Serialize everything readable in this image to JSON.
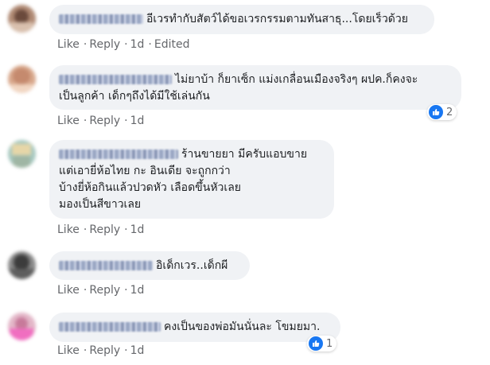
{
  "actions": {
    "like": "Like",
    "reply": "Reply",
    "dot": "·"
  },
  "comments": [
    {
      "text": "อีเวรทำกับสัตว์ได้ขอเวรกรรมตามทันสาธุ...โดยเร็วด้วย",
      "time": "1d",
      "edited": "Edited"
    },
    {
      "text": "ไม่ยาบ้า ก็ยาเซ็ก แม่งเกลื่อนเมืองจริงๆ ผปค.ก็คงจะ\nเป็นลูกค้า เด็กๆถึงได้มีใช้เล่นกัน",
      "time": "1d",
      "reactions": "2"
    },
    {
      "text": "ร้านขายยา มีครับแอบขาย\nแต่เอายี่ห้อไทย กะ อินเดีย จะถูกกว่า\nบ้างยี่ห้อกินแล้วปวดหัว เลือดขึ้นหัวเลย\nมองเป็นสีขาวเลย",
      "time": "1d"
    },
    {
      "text": "อิเด็กเวร..เด็กผี",
      "time": "1d"
    },
    {
      "text": "คงเป็นของพ่อมันนั่นละ โขมยมา.",
      "time": "1d",
      "reactions": "1"
    }
  ],
  "colors": {
    "bubble": "#f0f2f5",
    "meta": "#65676b",
    "like_blue": "#1877f2"
  }
}
